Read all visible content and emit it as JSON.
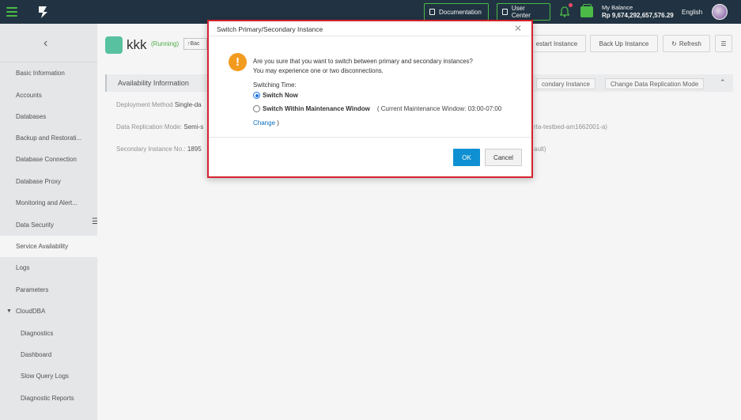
{
  "topbar": {
    "documentation": "Documentation",
    "user_center": "User Center",
    "balance_label": "My Balance",
    "balance_value": "Rp 9,674,292,657,576.29",
    "language": "English",
    "accent": "#4fc24a"
  },
  "sidebar": {
    "items": [
      "Basic Information",
      "Accounts",
      "Databases",
      "Backup and Restorati...",
      "Database Connection",
      "Database Proxy",
      "Monitoring and Alert...",
      "Data Security",
      "Service Availability",
      "Logs",
      "Parameters",
      "CloudDBA"
    ],
    "subitems": [
      "Diagnostics",
      "Dashboard",
      "Slow Query Logs",
      "Diagnostic Reports"
    ]
  },
  "instance": {
    "name": "kkk",
    "status": "(Running)",
    "back": "↑Bac",
    "restart": "estart Instance",
    "backup": "Back Up Instance",
    "refresh": "Refresh"
  },
  "panel": {
    "title": "Availability Information",
    "link1": "condary Instance",
    "link2": "Change Data Replication Mode",
    "deployment_label": "Deployment Method",
    "deployment_value": "Single-da",
    "replication_label": "Data Replication Mode:",
    "replication_value": "Semi-s",
    "replication_tail": "rta-testbed-am1662001-a)",
    "secondary_label": "Secondary Instance No.:",
    "secondary_value": "1895",
    "secondary_tail": "ault)"
  },
  "modal": {
    "title": "Switch Primary/Secondary Instance",
    "message_line1": "Are you sure that you want to switch between primary and secondary instances?",
    "message_line2": "You may experience one or two disconnections.",
    "switching_time_label": "Switching Time:",
    "option_now": "Switch Now",
    "option_window": "Switch Within Maintenance Window",
    "window_note": "( Current Maintenance Window: 03:00-07:00",
    "change_link": "Change",
    "change_close": ")",
    "ok": "OK",
    "cancel": "Cancel",
    "highlight_color": "#d5232f"
  }
}
